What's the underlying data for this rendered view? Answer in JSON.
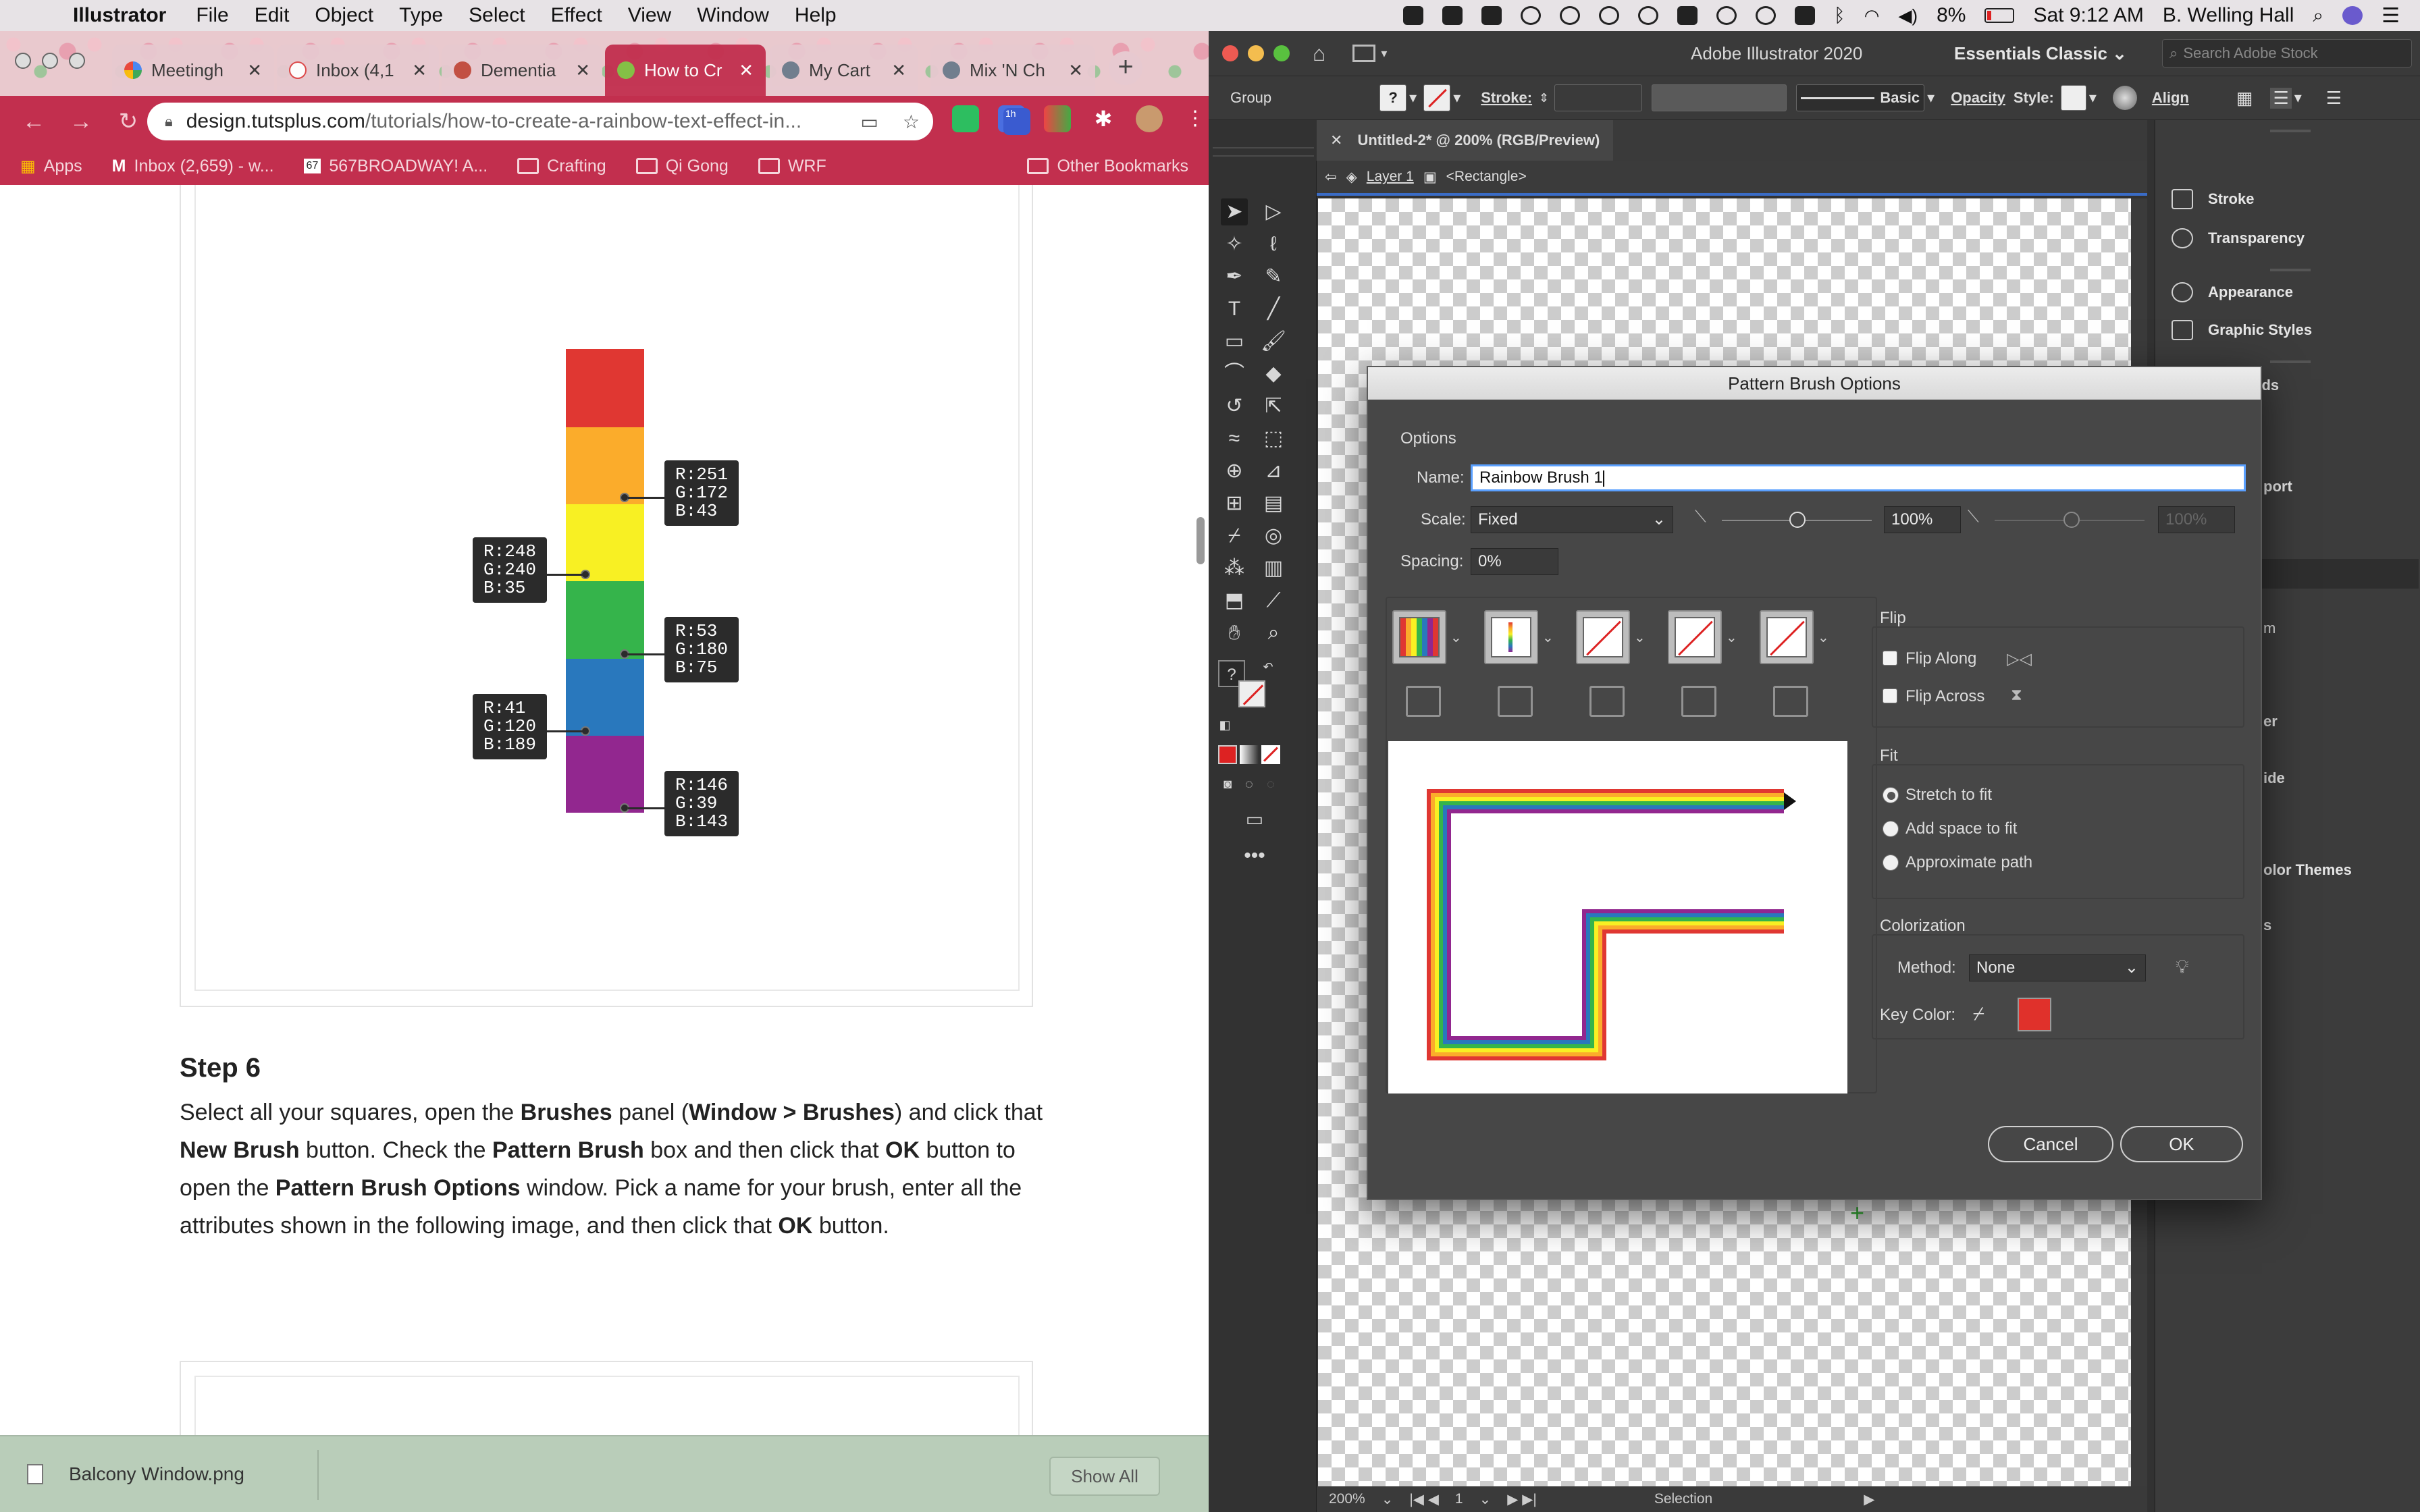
{
  "menubar": {
    "app": "Illustrator",
    "items": [
      "File",
      "Edit",
      "Object",
      "Type",
      "Select",
      "Effect",
      "View",
      "Window",
      "Help"
    ],
    "battery": "8%",
    "clock": "Sat 9:12 AM",
    "user": "B. Welling Hall"
  },
  "browser": {
    "tabs": [
      {
        "label": "Meetingh"
      },
      {
        "label": "Inbox (4,1"
      },
      {
        "label": "Dementia"
      },
      {
        "label": "How to Cr"
      },
      {
        "label": "My Cart"
      },
      {
        "label": "Mix 'N Ch"
      }
    ],
    "url_host": "design.tutsplus.com",
    "url_path": "/tutorials/how-to-create-a-rainbow-text-effect-in...",
    "bookmarks": [
      "Apps",
      "Inbox (2,659) - w...",
      "567BROADWAY! A...",
      "Crafting",
      "Qi Gong",
      "WRF",
      "Other Bookmarks"
    ],
    "download_file": "Balcony Window.png",
    "show_all": "Show All",
    "ext_badge": "1h"
  },
  "article": {
    "swatches": [
      {
        "hex": "#e03732"
      },
      {
        "hex": "#fbac2b"
      },
      {
        "hex": "#f8f023"
      },
      {
        "hex": "#35b44b"
      },
      {
        "hex": "#2978bd"
      },
      {
        "hex": "#92278f"
      }
    ],
    "callouts": [
      "R:251\nG:172\nB:43",
      "R:248\nG:240\nB:35",
      "R:53\nG:180\nB:75",
      "R:41\nG:120\nB:189",
      "R:146\nG:39\nB:143"
    ],
    "step_title": "Step 6",
    "step_parts": [
      "Select all your squares, open the ",
      "Brushes",
      " panel (",
      "Window > Brushes",
      ") and click that ",
      "New Brush",
      " button. Check the ",
      "Pattern Brush",
      " box and then click that ",
      "OK",
      " button to open the ",
      "Pattern Brush Options",
      " window. Pick a name for your brush, enter all the attributes shown in the following image, and then click that ",
      "OK",
      " button."
    ]
  },
  "illustrator": {
    "title": "Adobe Illustrator 2020",
    "workspace": "Essentials Classic",
    "search_placeholder": "Search Adobe Stock",
    "control": {
      "selection": "Group",
      "stroke_label": "Stroke:",
      "brush_label": "Basic",
      "opacity_label": "Opacity",
      "style_label": "Style:",
      "align_label": "Align"
    },
    "doc_tab": "Untitled-2* @ 200% (RGB/Preview)",
    "breadcrumb": {
      "layer": "Layer 1",
      "object": "<Rectangle>"
    },
    "status": {
      "zoom": "200%",
      "artboard": "1",
      "mode": "Selection"
    },
    "panels": [
      "Stroke",
      "Transparency",
      "Appearance",
      "Graphic Styles",
      "Artboards"
    ],
    "panel_fragments": [
      "port",
      "m",
      "er",
      "ide",
      "olor Themes",
      "s"
    ]
  },
  "dialog": {
    "title": "Pattern Brush Options",
    "options_label": "Options",
    "name_label": "Name:",
    "name_value": "Rainbow Brush 1",
    "scale_label": "Scale:",
    "scale_value": "Fixed",
    "scale_pct": "100%",
    "scale_pct2": "100%",
    "spacing_label": "Spacing:",
    "spacing_value": "0%",
    "flip_label": "Flip",
    "flip_along": "Flip Along",
    "flip_across": "Flip Across",
    "fit_label": "Fit",
    "fit_options": [
      "Stretch to fit",
      "Add space to fit",
      "Approximate path"
    ],
    "fit_selected": "Stretch to fit",
    "colorization_label": "Colorization",
    "method_label": "Method:",
    "method_value": "None",
    "keycolor_label": "Key Color:",
    "keycolor": "#e0312b",
    "cancel": "Cancel",
    "ok": "OK"
  }
}
